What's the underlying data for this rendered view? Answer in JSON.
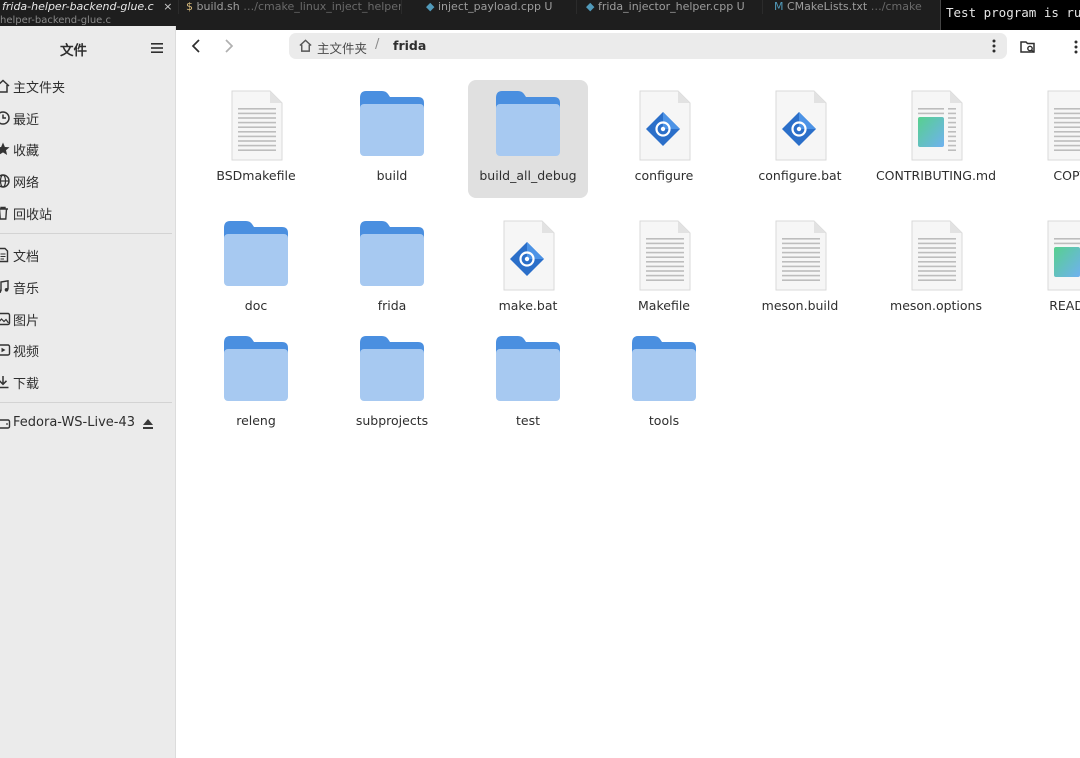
{
  "editor": {
    "tabs": [
      {
        "label": "frida-helper-backend-glue.c",
        "close": "×",
        "active": true
      },
      {
        "label": "build.sh",
        "suffix": "…/cmake_linux_inject_helper U"
      },
      {
        "label": "inject_payload.cpp U"
      },
      {
        "label": "frida_injector_helper.cpp U"
      },
      {
        "label": "CMakeLists.txt",
        "suffix": "…/cmake"
      }
    ],
    "breadcrumb": "helper-backend-glue.c",
    "terminal_line": "Test program is ru"
  },
  "sidebar": {
    "title": "文件",
    "items": [
      {
        "label": "主文件夹",
        "icon": "home-icon"
      },
      {
        "label": "最近",
        "icon": "clock-icon"
      },
      {
        "label": "收藏",
        "icon": "star-icon"
      },
      {
        "label": "网络",
        "icon": "network-icon"
      },
      {
        "label": "回收站",
        "icon": "trash-icon"
      },
      {
        "label": "文档",
        "icon": "document-icon"
      },
      {
        "label": "音乐",
        "icon": "music-icon"
      },
      {
        "label": "图片",
        "icon": "picture-icon"
      },
      {
        "label": "视频",
        "icon": "video-icon"
      },
      {
        "label": "下载",
        "icon": "download-icon"
      },
      {
        "label": "Fedora-WS-Live-43",
        "icon": "drive-icon",
        "eject": "eject-icon"
      }
    ]
  },
  "header": {
    "crumb_home": "主文件夹",
    "crumb_sep": "/",
    "crumb_current": "frida"
  },
  "files": [
    {
      "name": "BSDmakefile",
      "type": "text"
    },
    {
      "name": "build",
      "type": "folder"
    },
    {
      "name": "build_all_debug",
      "type": "folder",
      "selected": true
    },
    {
      "name": "configure",
      "type": "script"
    },
    {
      "name": "configure.bat",
      "type": "script"
    },
    {
      "name": "CONTRIBUTING.md",
      "type": "markdown"
    },
    {
      "name": "COPYI",
      "type": "text"
    },
    {
      "name": "doc",
      "type": "folder"
    },
    {
      "name": "frida",
      "type": "folder"
    },
    {
      "name": "make.bat",
      "type": "script"
    },
    {
      "name": "Makefile",
      "type": "text"
    },
    {
      "name": "meson.build",
      "type": "text"
    },
    {
      "name": "meson.options",
      "type": "text"
    },
    {
      "name": "READM",
      "type": "markdown"
    },
    {
      "name": "releng",
      "type": "folder"
    },
    {
      "name": "subprojects",
      "type": "folder"
    },
    {
      "name": "test",
      "type": "folder"
    },
    {
      "name": "tools",
      "type": "folder"
    }
  ],
  "colors": {
    "folder_back": "#4a8fe0",
    "folder_front": "#a7c9f1",
    "sidebar_bg": "#ebebeb",
    "selected_tile": "#e0e0e0"
  }
}
